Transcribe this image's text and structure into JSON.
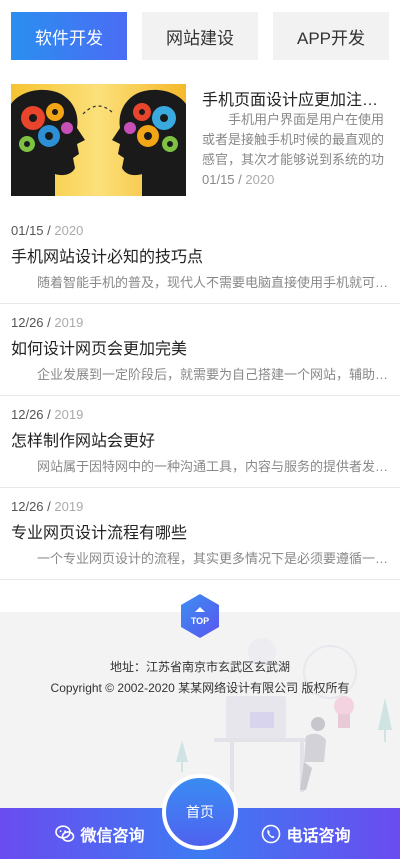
{
  "tabs": [
    {
      "label": "软件开发",
      "active": true
    },
    {
      "label": "网站建设",
      "active": false
    },
    {
      "label": "APP开发",
      "active": false
    }
  ],
  "feature": {
    "title": "手机页面设计应更加注重用户体验",
    "desc": "手机用户界面是用户在使用或者是接触手机时候的最直观的感官，其次才能够说到系统的功能",
    "date_md": "01/15",
    "date_year": "2020"
  },
  "news": [
    {
      "date_md": "01/15",
      "date_year": "2020",
      "title": "手机网站设计必知的技巧点",
      "desc": "随着智能手机的普及，现代人不需要电脑直接使用手机就可以浏览网站"
    },
    {
      "date_md": "12/26",
      "date_year": "2019",
      "title": "如何设计网页会更加完美",
      "desc": "企业发展到一定阶段后，就需要为自己搭建一个网站，辅助企业发展"
    },
    {
      "date_md": "12/26",
      "date_year": "2019",
      "title": "怎样制作网站会更好",
      "desc": "网站属于因特网中的一种沟通工具，内容与服务的提供者发布信息"
    },
    {
      "date_md": "12/26",
      "date_year": "2019",
      "title": "专业网页设计流程有哪些",
      "desc": "一个专业网页设计的流程，其实更多情况下是必须要遵循一定的步骤"
    }
  ],
  "footer": {
    "top_label": "TOP",
    "address": "地址：江苏省南京市玄武区玄武湖",
    "copyright": "Copyright © 2002-2020 某某网络设计有限公司 版权所有"
  },
  "bottom_bar": {
    "left_label": "微信咨询",
    "left_icon": "wechat-icon",
    "home_label": "首页",
    "right_label": "电话咨询",
    "right_icon": "phone-icon"
  },
  "colors": {
    "accent": "#3e7af2",
    "accent_purple": "#6a4cf0"
  }
}
